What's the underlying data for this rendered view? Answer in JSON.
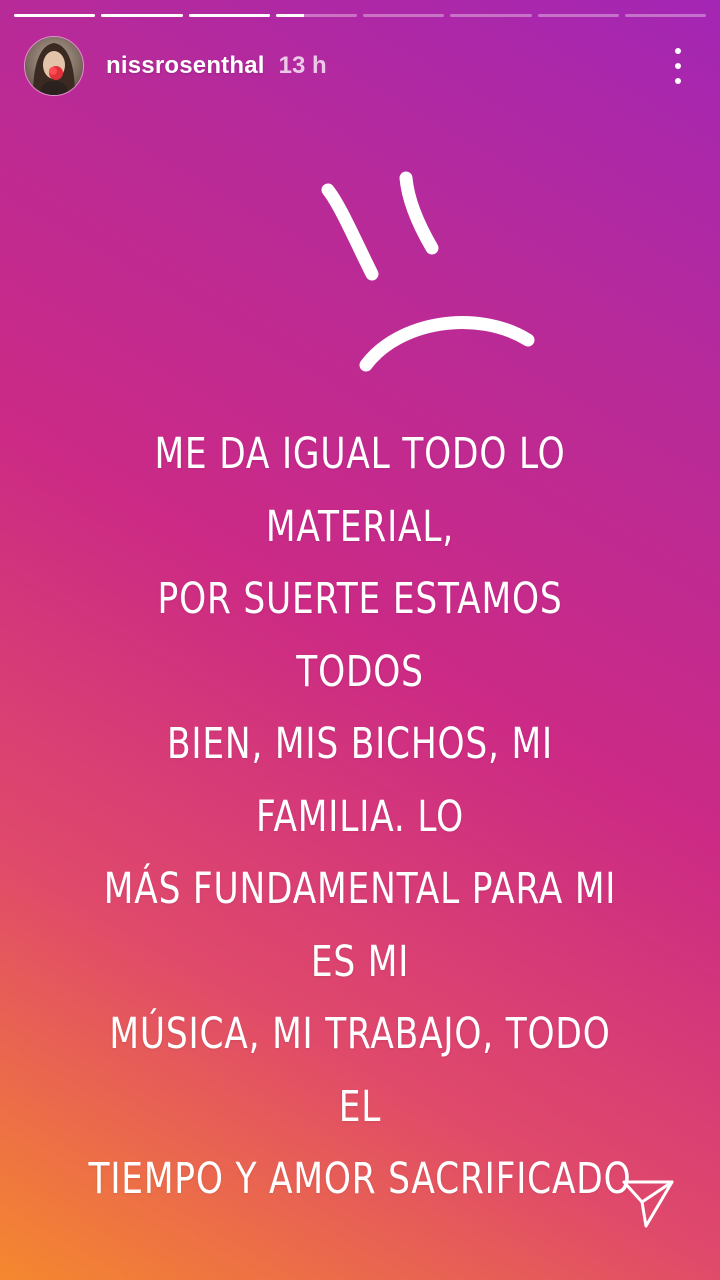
{
  "story": {
    "segments": [
      {
        "progress": 1.0
      },
      {
        "progress": 1.0
      },
      {
        "progress": 1.0
      },
      {
        "progress": 0.35
      },
      {
        "progress": 0.0
      },
      {
        "progress": 0.0
      },
      {
        "progress": 0.0
      },
      {
        "progress": 0.0
      }
    ],
    "gradient_colors": [
      "#f5882e",
      "#e04a6a",
      "#cc2a85",
      "#a326b4"
    ]
  },
  "header": {
    "username": "nissrosenthal",
    "time": "13 h",
    "more_icon": "more-vertical-icon"
  },
  "content": {
    "sticker": "sad-face-doodle",
    "text": "ME DA IGUAL TODO LO MATERIAL,\nPOR SUERTE ESTAMOS TODOS\nBIEN, MIS BICHOS, MI FAMILIA. LO\nMÁS FUNDAMENTAL PARA MI ES MI\nMÚSICA, MI TRABAJO, TODO EL\nTIEMPO Y AMOR SACRIFICADO"
  },
  "footer": {
    "send_icon": "send-icon"
  }
}
